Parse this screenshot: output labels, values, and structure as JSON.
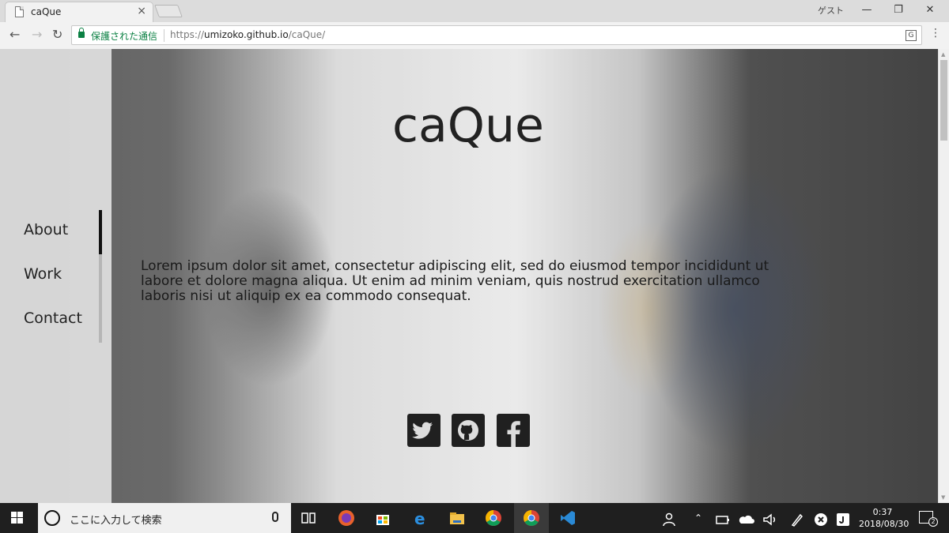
{
  "browser": {
    "tab_title": "caQue",
    "tab_close": "×",
    "profile": "ゲスト",
    "security_label": "保護された通信",
    "url_scheme": "https://",
    "url_host": "umizoko.github.io",
    "url_path": "/caQue/"
  },
  "site": {
    "title": "caQue",
    "nav": [
      "About",
      "Work",
      "Contact"
    ],
    "active_nav": "About",
    "body_text": "Lorem ipsum dolor sit amet, consectetur adipiscing elit, sed do eiusmod tempor incididunt ut labore et dolore magna aliqua. Ut enim ad minim veniam, quis nostrud exercitation ullamco laboris nisi ut aliquip ex ea commodo consequat.",
    "social": [
      "twitter-icon",
      "github-icon",
      "facebook-icon"
    ]
  },
  "taskbar": {
    "search_placeholder": "ここに入力して検索",
    "time": "0:37",
    "date": "2018/08/30",
    "notification_count": "2"
  },
  "colors": {
    "secure_green": "#0b8043",
    "taskbar": "#1f1f1f",
    "icon_dark": "#202020"
  }
}
